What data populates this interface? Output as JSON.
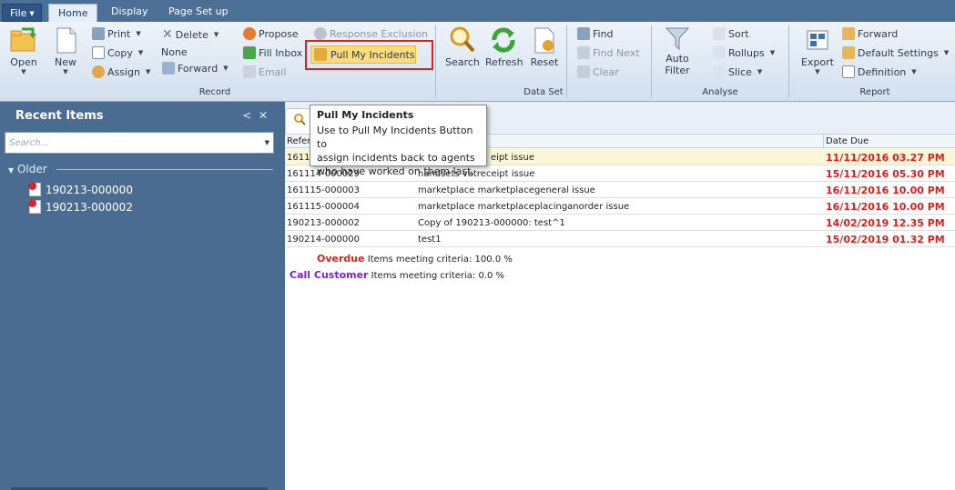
{
  "tabs": {
    "file": "File",
    "home": "Home",
    "display": "Display",
    "page_setup": "Page Set up"
  },
  "record": {
    "open": "Open",
    "new": "New",
    "print": "Print",
    "copy": "Copy",
    "assign": "Assign",
    "delete": "Delete",
    "none": "None",
    "forward": "Forward",
    "propose": "Propose",
    "fill_inbox": "Fill Inbox",
    "email": "Email",
    "response_exclusion": "Response Exclusion",
    "pull_my_incidents": "Pull My Incidents",
    "label": "Record"
  },
  "dataset": {
    "search": "Search",
    "refresh": "Refresh",
    "reset": "Reset",
    "find": "Find",
    "find_next": "Find Next",
    "clear": "Clear",
    "label": "Data Set"
  },
  "analyse": {
    "auto": "Auto",
    "filter": "Filter",
    "sort": "Sort",
    "rollups": "Rollups",
    "slice": "Slice",
    "label": "Analyse"
  },
  "report": {
    "export": "Export",
    "forward": "Forward",
    "default_settings": "Default Settings",
    "definition": "Definition",
    "label": "Report"
  },
  "left_panel": {
    "title": "Recent Items",
    "search_placeholder": "Search...",
    "group": "Older",
    "items": [
      "190213-000000",
      "190213-000002"
    ]
  },
  "table": {
    "col_ref": "Refer",
    "col_date": "Date Due",
    "rows": [
      {
        "ref": "1611",
        "subject": "eipt issue",
        "due": "11/11/2016 03.27 PM"
      },
      {
        "ref": "161114-000029",
        "subject": "handsets vatreceipt issue",
        "due": "15/11/2016 05.30 PM"
      },
      {
        "ref": "161115-000003",
        "subject": "marketplace marketplacegeneral issue",
        "due": "16/11/2016 10.00 PM"
      },
      {
        "ref": "161115-000004",
        "subject": "marketplace marketplaceplacinganorder issue",
        "due": "16/11/2016 10.00 PM"
      },
      {
        "ref": "190213-000002",
        "subject": "Copy of 190213-000000: test^1",
        "due": "14/02/2019 12.35 PM"
      },
      {
        "ref": "190214-000000",
        "subject": "test1",
        "due": "15/02/2019 01.32 PM"
      }
    ]
  },
  "legend": {
    "overdue_label": "Overdue",
    "overdue_text": "Items meeting criteria: 100.0 %",
    "call_label": "Call Customer",
    "call_text": "Items meeting criteria: 0.0 %"
  },
  "tooltip": {
    "title": "Pull My Incidents",
    "line1": "Use to Pull My Incidents Button to",
    "line2": "assign incidents back to agents",
    "line3": "who have worked on them last."
  },
  "colors": {
    "overdue": "#d8231b",
    "call_customer": "#7a1fd0",
    "due_date": "#e21b1b",
    "highlight": "#fbdc7a"
  }
}
